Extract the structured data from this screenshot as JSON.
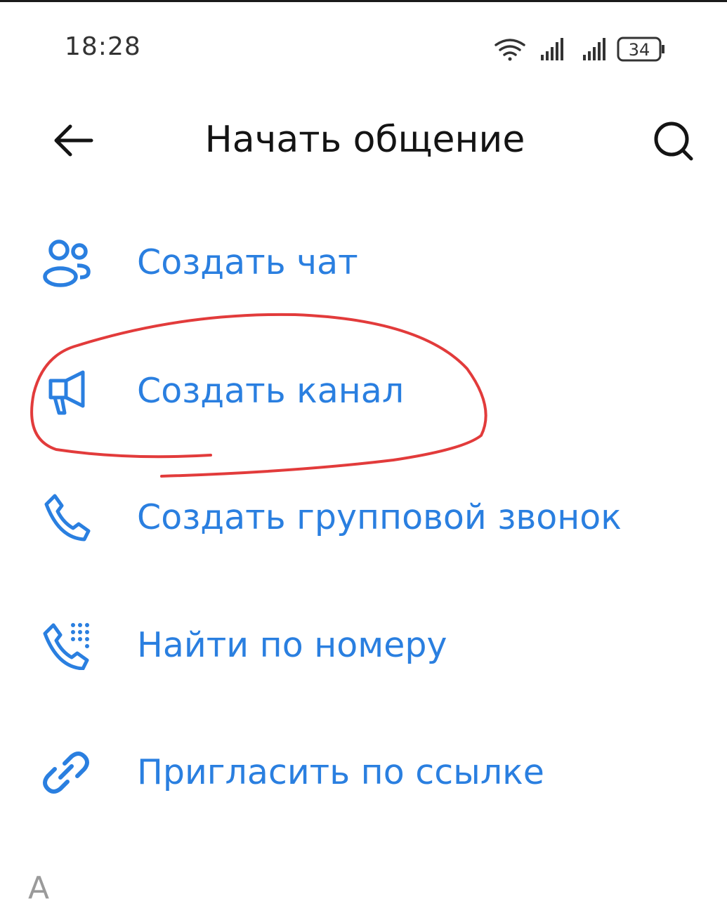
{
  "status_bar": {
    "time": "18:28",
    "battery": "34"
  },
  "header": {
    "title": "Начать общение"
  },
  "menu": {
    "items": [
      {
        "label": "Создать чат",
        "icon": "people-icon"
      },
      {
        "label": "Создать канал",
        "icon": "megaphone-icon"
      },
      {
        "label": "Создать групповой звонок",
        "icon": "phone-icon"
      },
      {
        "label": "Найти по номеру",
        "icon": "phone-keypad-icon"
      },
      {
        "label": "Пригласить по ссылке",
        "icon": "link-icon"
      }
    ]
  },
  "section": {
    "letter": "А"
  },
  "colors": {
    "accent": "#2a7fe0",
    "annotation": "#e23b3b",
    "title": "#141414"
  }
}
